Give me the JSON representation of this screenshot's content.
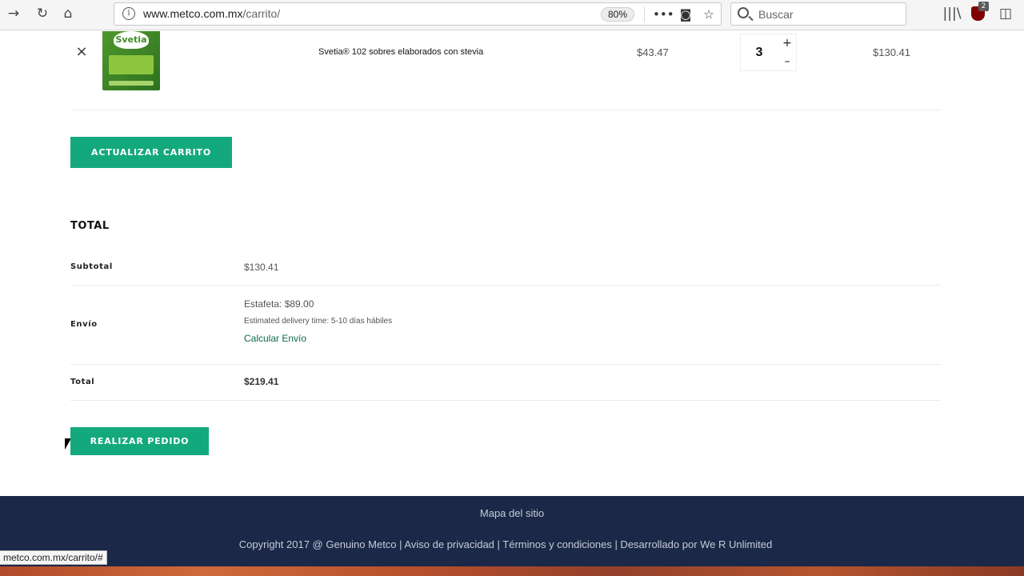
{
  "browser": {
    "url_host": "www.metco.com.mx",
    "url_path": "/carrito/",
    "zoom": "80%",
    "search_placeholder": "Buscar",
    "badge_count": "2",
    "status_url": "metco.com.mx/carrito/#"
  },
  "cart_item": {
    "image_logo": "Svetia",
    "name": "Svetia® 102 sobres elaborados con stevia",
    "price": "$43.47",
    "quantity": "3",
    "plus": "+",
    "minus": "–",
    "subtotal": "$130.41",
    "remove": "×"
  },
  "actions": {
    "update_cart": "ACTUALIZAR CARRITO",
    "place_order": "REALIZAR PEDIDO"
  },
  "totals": {
    "title": "TOTAL",
    "subtotal_label": "Subtotal",
    "subtotal_value": "$130.41",
    "shipping_label": "Envío",
    "shipping_method": "Estafeta: $89.00",
    "delivery_time": "Estimated delivery time: 5-10 días hábiles",
    "calc_shipping": "Calcular Envío",
    "total_label": "Total",
    "total_value": "$219.41"
  },
  "footer": {
    "sitemap": "Mapa del sitio",
    "copyright": "Copyright 2017 @ Genuino Metco | Aviso de privacidad | Términos y condiciones | Desarrollado por We R Unlimited"
  },
  "colors": {
    "button": "#14a97c",
    "footer_bg": "#1b2848",
    "link": "#0a6a4f"
  }
}
